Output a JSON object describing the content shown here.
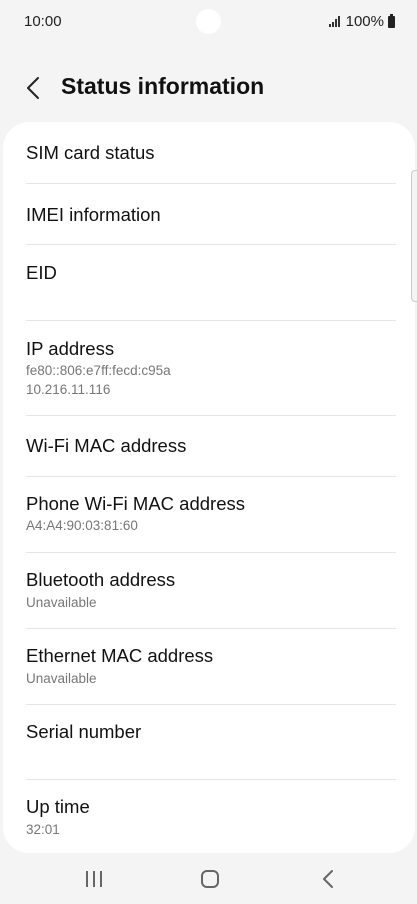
{
  "status_bar": {
    "time": "10:00",
    "battery_text": "100%",
    "icons": [
      "signal-icon",
      "battery-icon"
    ]
  },
  "header": {
    "title": "Status information",
    "back_icon": "back-arrow-icon"
  },
  "items": [
    {
      "label": "SIM card status",
      "sub1": "",
      "sub2": ""
    },
    {
      "label": "IMEI information",
      "sub1": "",
      "sub2": ""
    },
    {
      "label": "EID",
      "sub1": "",
      "sub2": ""
    },
    {
      "label": "IP address",
      "sub1": "fe80::806:e7ff:fecd:c95a",
      "sub2": "10.216.11.116"
    },
    {
      "label": "Wi-Fi MAC address",
      "sub1": "",
      "sub2": ""
    },
    {
      "label": "Phone Wi-Fi MAC address",
      "sub1": "A4:A4:90:03:81:60",
      "sub2": ""
    },
    {
      "label": "Bluetooth address",
      "sub1": "Unavailable",
      "sub2": ""
    },
    {
      "label": "Ethernet MAC address",
      "sub1": "Unavailable",
      "sub2": ""
    },
    {
      "label": "Serial number",
      "sub1": "",
      "sub2": ""
    },
    {
      "label": "Up time",
      "sub1": "32:01",
      "sub2": ""
    }
  ],
  "nav_bar": {
    "icons": [
      "recent-apps-icon",
      "home-icon",
      "back-icon"
    ]
  }
}
